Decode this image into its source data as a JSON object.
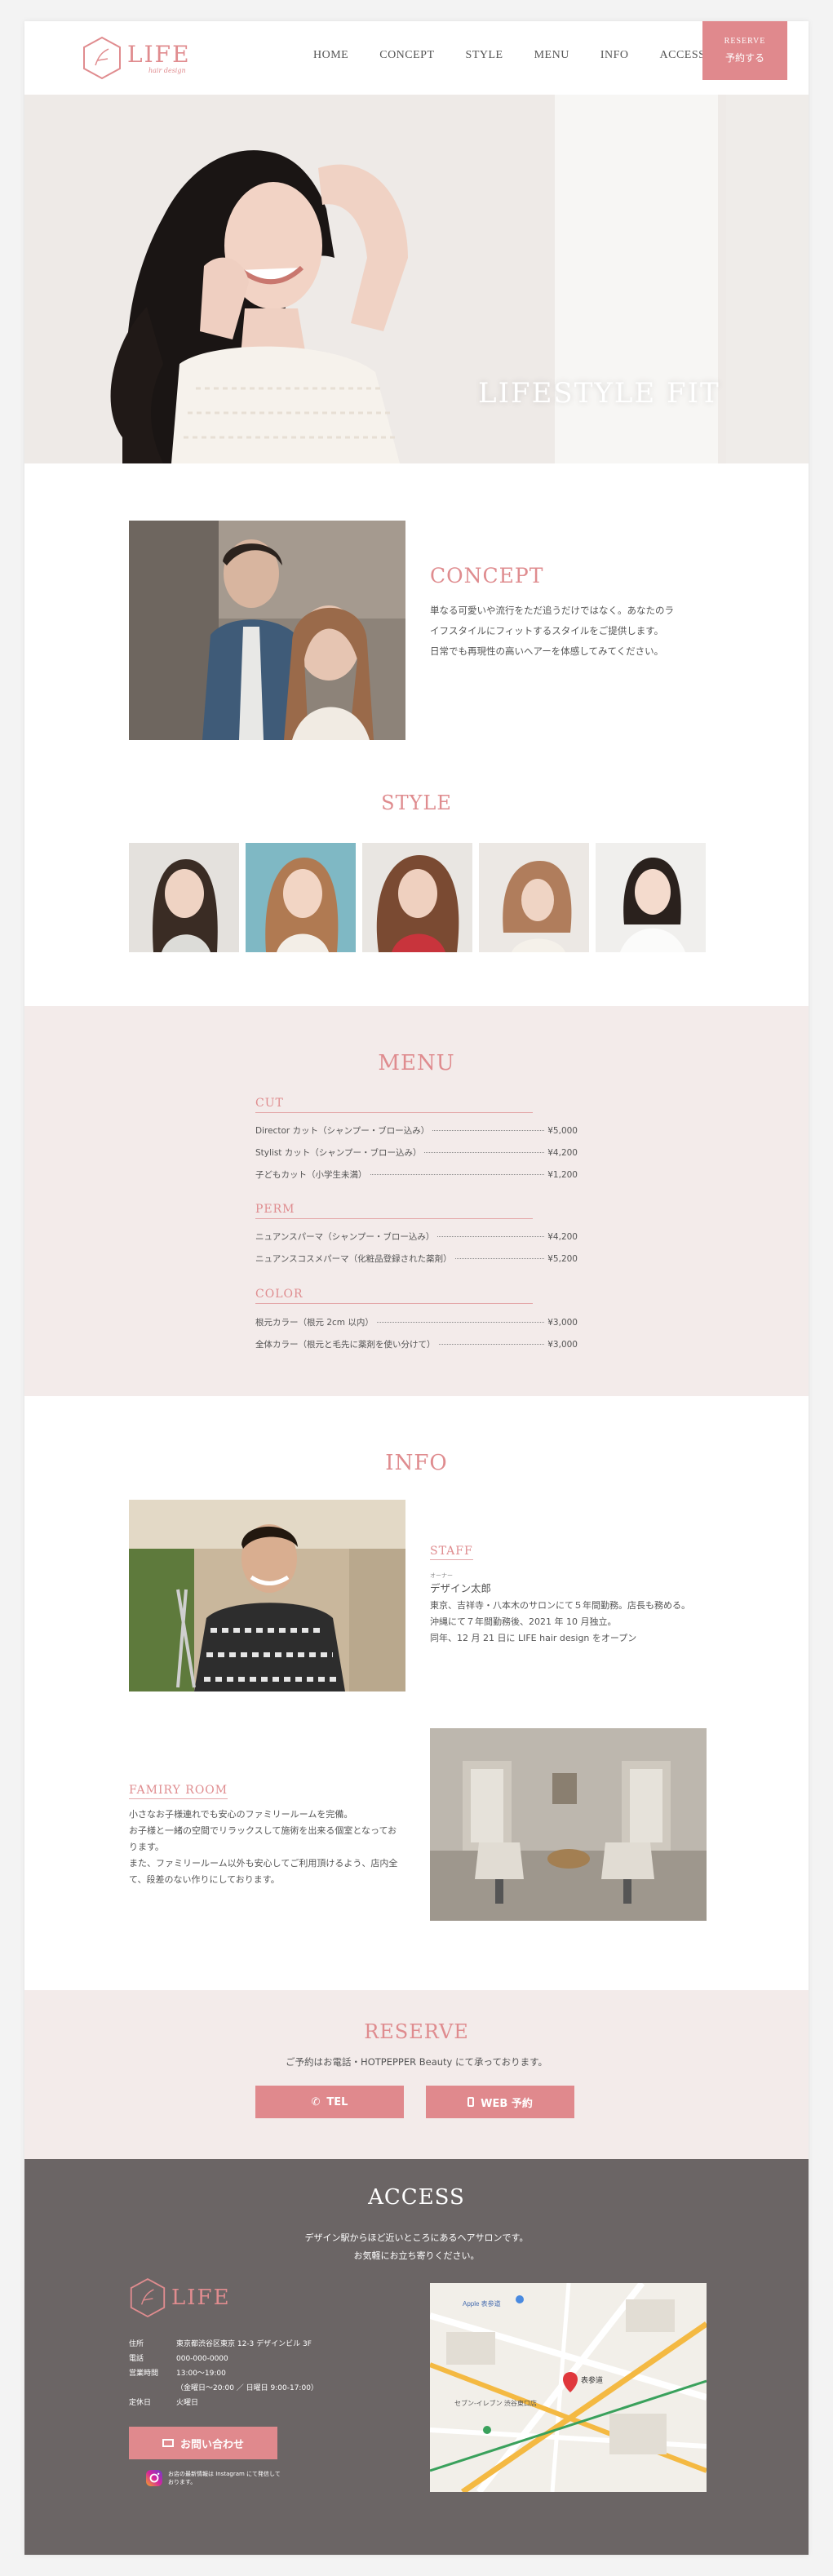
{
  "header": {
    "logo_word": "LIFE",
    "logo_sub": "hair design",
    "nav": [
      "HOME",
      "CONCEPT",
      "STYLE",
      "MENU",
      "INFO",
      "ACCESS"
    ],
    "reserve_en": "RESERVE",
    "reserve_jp": "予約する"
  },
  "hero": {
    "copy": "LIFESTYLE FIT"
  },
  "concept": {
    "title": "CONCEPT",
    "lines": [
      "単なる可愛いや流行をただ追うだけではなく。あなたのラ",
      "イフスタイルにフィットするスタイルをご提供します。",
      "日常でも再現性の高いヘアーを体感してみてください。"
    ]
  },
  "style": {
    "title": "STYLE"
  },
  "menu": {
    "title": "MENU",
    "categories": [
      {
        "name": "CUT",
        "items": [
          {
            "name": "Director カット（シャンプー・ブロー込み）",
            "price": "¥5,000"
          },
          {
            "name": "Stylist カット（シャンプー・ブロー込み）",
            "price": "¥4,200"
          },
          {
            "name": "子どもカット（小学生未満）",
            "price": "¥1,200"
          }
        ]
      },
      {
        "name": "PERM",
        "items": [
          {
            "name": "ニュアンスパーマ（シャンプー・ブロー込み）",
            "price": "¥4,200"
          },
          {
            "name": "ニュアンスコスメパーマ（化粧品登録された薬剤）",
            "price": "¥5,200"
          }
        ]
      },
      {
        "name": "COLOR",
        "items": [
          {
            "name": "根元カラー（根元 2cm 以内）",
            "price": "¥3,000"
          },
          {
            "name": "全体カラー（根元と毛先に薬剤を使い分けて）",
            "price": "¥3,000"
          }
        ]
      }
    ]
  },
  "info": {
    "title": "INFO",
    "staff_title": "STAFF",
    "staff_ruby": "オーナー",
    "staff_name": "デザイン太郎",
    "staff_lines": [
      "東京、吉祥寺・八本木のサロンにて５年間勤務。店長も務める。",
      "沖縄にて７年間勤務後、2021 年 10 月独立。",
      "同年、12 月 21 日に LIFE hair design をオープン"
    ],
    "family_title": "FAMIRY ROOM",
    "family_lines": [
      "小さなお子様連れでも安心のファミリールームを完備。",
      "お子様と一緒の空間でリラックスして施術を出来る個室となってお",
      "ります。",
      "また、ファミリールーム以外も安心してご利用頂けるよう、店内全",
      "て、段差のない作りにしております。"
    ]
  },
  "reserve": {
    "title": "RESERVE",
    "text": "ご予約はお電話・HOTPEPPER Beauty にて承っております。",
    "tel": "TEL",
    "web": "WEB 予約"
  },
  "access": {
    "title": "ACCESS",
    "lead": [
      "デザイン駅からほど近いところにあるヘアサロンです。",
      "お気軽にお立ち寄りください。"
    ],
    "rows": [
      {
        "k": "住所",
        "v": "東京都渋谷区東京 12-3 デザインビル 3F"
      },
      {
        "k": "電話",
        "v": "000-000-0000"
      },
      {
        "k": "営業時間",
        "v": "13:00～19:00"
      },
      {
        "k": "",
        "v": "（金曜日～20:00 ／ 日曜日 9:00-17:00）"
      },
      {
        "k": "定休日",
        "v": "火曜日"
      }
    ],
    "contact": "お問い合わせ",
    "insta": "お店の最新情報は Instagram にて発信しております。",
    "map_labels": [
      "Apple 表参道",
      "セブン-イレブン 渋谷東口店",
      "表参道"
    ]
  },
  "colors": {
    "accent": "#e0898d",
    "menu_bg": "#f3ebea",
    "footer_bg": "#6b6565"
  }
}
